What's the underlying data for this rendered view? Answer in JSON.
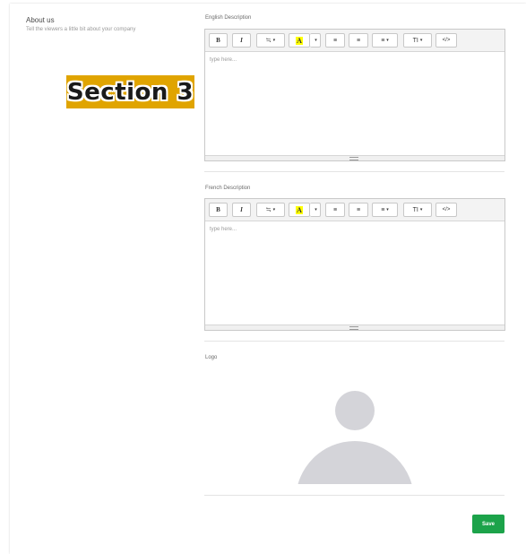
{
  "about": {
    "title": "About us",
    "subtitle": "Tell the viewers a little bit about your company"
  },
  "overlay": {
    "label": "Section 3"
  },
  "english": {
    "label": "English Description",
    "placeholder": "type here..."
  },
  "french": {
    "label": "French Description",
    "placeholder": "type here..."
  },
  "toolbar": {
    "bold": "B",
    "italic": "I",
    "font_size": "≒",
    "highlight": "A",
    "bullet_list": "≡",
    "numbered_list": "≡",
    "align": "≡",
    "text_height": "TI",
    "code_view": "</>",
    "dropdown_caret": "▾"
  },
  "logo": {
    "label": "Logo"
  },
  "actions": {
    "save": "Save"
  },
  "colors": {
    "save_green": "#1ca34a",
    "highlight_yellow": "#ffff00",
    "overlay_gold": "#e0a400",
    "avatar_gray": "#d4d4d9"
  }
}
